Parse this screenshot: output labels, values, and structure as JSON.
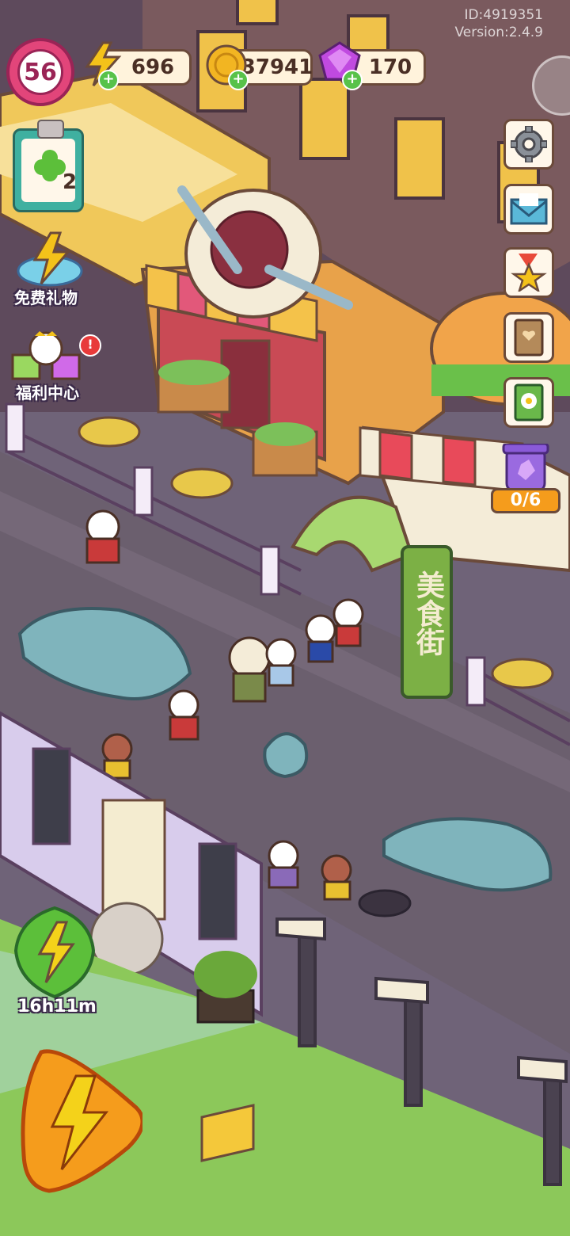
{
  "meta": {
    "id_text": "ID:4919351",
    "version_text": "Version:2.4.9"
  },
  "hud": {
    "level": "56",
    "energy": "696",
    "coins": "37941",
    "gems": "170"
  },
  "left_panel": {
    "quest_count": "2",
    "free_gift_label": "免费礼物",
    "welfare_label": "福利中心",
    "welfare_badge": "!"
  },
  "right_panel": {
    "jar_progress": "0/6",
    "icons": [
      "gear-icon",
      "mail-icon",
      "medal-icon",
      "book-icon",
      "album-icon"
    ]
  },
  "bottom": {
    "boost_timer": "16h11m"
  },
  "scene": {
    "food_street_sign": "美食街"
  },
  "colors": {
    "level_ring": "#e2457a",
    "energy_green": "#5cbf3a",
    "boost_orange": "#f59c1c",
    "gem_purple": "#b23bd8",
    "coin_gold": "#f2b522"
  }
}
